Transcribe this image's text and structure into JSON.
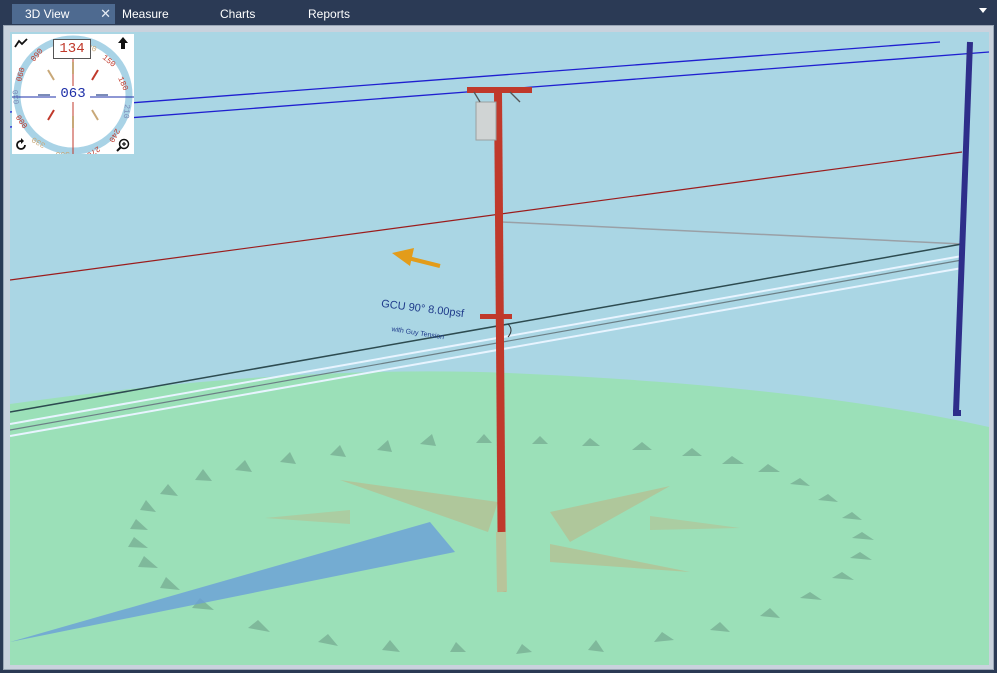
{
  "tabs": [
    {
      "label": "3D View",
      "active": true,
      "close": "✕"
    },
    {
      "label": "Measure",
      "active": false
    },
    {
      "label": "Charts",
      "active": false
    },
    {
      "label": "Reports",
      "active": false
    }
  ],
  "compass": {
    "heading_top": "134",
    "heading_center": "063",
    "ring_labels": [
      "090",
      "060",
      "030",
      "000",
      "330",
      "300",
      "270",
      "240",
      "210",
      "180",
      "150",
      "120"
    ]
  },
  "scene": {
    "load_case_label": "GCU 90° 8.00psf",
    "load_case_sublabel": "with Guy Tension"
  },
  "colors": {
    "tabbar": "#2b3a55",
    "active_tab": "#4e6a90",
    "sky": "#aad6e4",
    "ground": "#9be0b8",
    "pole": "#c0392b",
    "wire_blue": "#1f1fd0",
    "wire_red": "#9b1c1c",
    "arrow": "#e39c1a",
    "shadow": "#6a9fd8"
  },
  "icons": [
    "terrain-icon",
    "north-arrow-icon",
    "rotate-icon",
    "zoom-icon",
    "chevron-down-icon"
  ]
}
